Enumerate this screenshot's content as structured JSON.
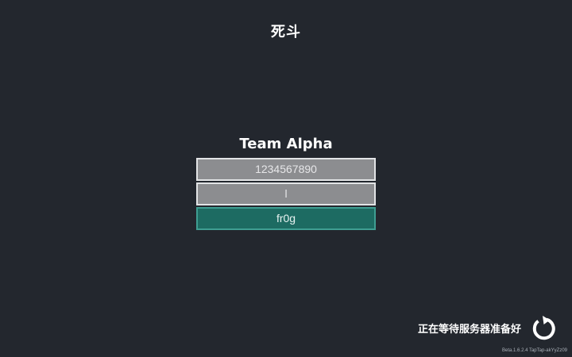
{
  "header": {
    "mode_title": "死斗"
  },
  "team": {
    "name": "Team Alpha",
    "players": [
      {
        "name": "1234567890",
        "is_self": false
      },
      {
        "name": "l",
        "is_self": false
      },
      {
        "name": "fr0g",
        "is_self": true
      }
    ]
  },
  "status": {
    "waiting_text": "正在等待服务器准备好",
    "icon": "loading-spinner-icon"
  },
  "footer": {
    "version": "Beta.1.6.2.4 TapTap-akYyZz09"
  },
  "colors": {
    "background": "#23272e",
    "slot_fill": "#8c8d90",
    "slot_border": "#e2e4e6",
    "self_slot_fill": "#1d6b62",
    "self_slot_border": "#3f9e92"
  }
}
